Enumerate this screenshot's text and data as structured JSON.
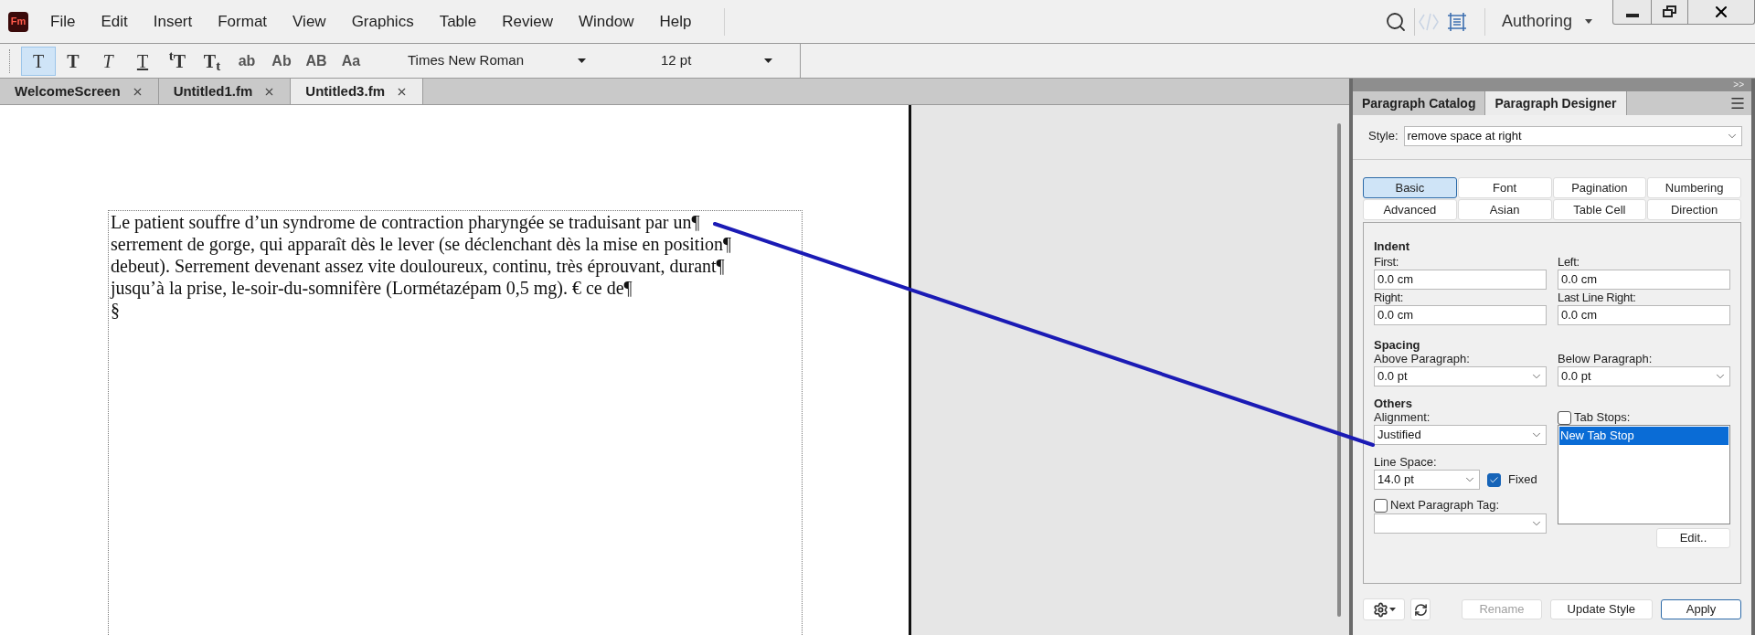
{
  "menu_bar": {
    "logo": "Fm",
    "items": [
      "File",
      "Edit",
      "Insert",
      "Format",
      "View",
      "Graphics",
      "Table",
      "Review",
      "Window",
      "Help"
    ],
    "workspace": "Authoring"
  },
  "toolbar": {
    "format_buttons": [
      {
        "label": "T",
        "kind": "plain",
        "selected": true
      },
      {
        "label": "T",
        "kind": "bold",
        "selected": false
      },
      {
        "label": "T",
        "kind": "italic",
        "selected": false
      },
      {
        "label": "T",
        "kind": "underline",
        "selected": false
      },
      {
        "label": "$^{t}$T",
        "kind": "raised",
        "selected": false
      },
      {
        "label": "T$_{t}$",
        "kind": "lowered",
        "selected": false
      },
      {
        "label": "ab",
        "kind": "case",
        "selected": false
      },
      {
        "label": "Ab",
        "kind": "case",
        "selected": false
      },
      {
        "label": "AB",
        "kind": "case",
        "selected": false
      },
      {
        "label": "Aa",
        "kind": "case",
        "selected": false
      }
    ],
    "font": "Times New Roman",
    "size": "12 pt"
  },
  "document_tabs": [
    {
      "label": "WelcomeScreen",
      "selected": false
    },
    {
      "label": "Untitled1.fm",
      "selected": false
    },
    {
      "label": "Untitled3.fm",
      "selected": true
    }
  ],
  "document": {
    "lines": [
      "Le patient souffre d’un syndrome de contraction pharyngée se traduisant par un¶",
      "serrement de gorge, qui apparaît dès le lever (se déclenchant dès la mise en position¶",
      "debeut). Serrement devenant assez vite douloureux, continu, très éprouvant, durant¶",
      "jusqu’à la prise, le-soir-du-somnifère (Lormétazépam 0,5 mg). € ce de¶",
      "§"
    ]
  },
  "panel": {
    "collapse": ">>",
    "tabs": [
      {
        "label": "Paragraph Catalog",
        "selected": false
      },
      {
        "label": "Paragraph Designer",
        "selected": true
      }
    ],
    "style_label": "Style:",
    "style": "remove space at right",
    "designer_tabs": [
      {
        "label": "Basic",
        "selected": true
      },
      {
        "label": "Font",
        "selected": false
      },
      {
        "label": "Pagination",
        "selected": false
      },
      {
        "label": "Numbering",
        "selected": false
      },
      {
        "label": "Advanced",
        "selected": false
      },
      {
        "label": "Asian",
        "selected": false
      },
      {
        "label": "Table Cell",
        "selected": false
      },
      {
        "label": "Direction",
        "selected": false
      }
    ],
    "indent": {
      "title": "Indent",
      "fields": [
        {
          "label": "First:",
          "value": "0.0 cm"
        },
        {
          "label": "Left:",
          "value": "0.0 cm"
        },
        {
          "label": "Right:",
          "value": "0.0 cm"
        },
        {
          "label": "Last Line Right:",
          "value": "0.0 cm"
        }
      ]
    },
    "spacing": {
      "title": "Spacing",
      "fields": [
        {
          "label": "Above Paragraph:",
          "value": "0.0 pt"
        },
        {
          "label": "Below Paragraph:",
          "value": "0.0 pt"
        }
      ]
    },
    "others": {
      "title": "Others",
      "alignment_label": "Alignment:",
      "alignment": "Justified",
      "line_space_label": "Line Space:",
      "line_space": "14.0 pt",
      "fixed": {
        "label": "Fixed",
        "checked": true
      },
      "next_tag": {
        "label": "Next Paragraph Tag:",
        "checked": false
      },
      "tab_stops": {
        "label": "Tab Stops:",
        "checked": false,
        "items": [
          {
            "label": "New Tab Stop",
            "selected": true
          }
        ]
      },
      "edit_button": "Edit.."
    },
    "footer_buttons": [
      {
        "label": "Rename",
        "disabled": true,
        "default": false
      },
      {
        "label": "Update Style",
        "disabled": false,
        "default": false
      },
      {
        "label": "Apply",
        "disabled": false,
        "default": true
      }
    ]
  }
}
